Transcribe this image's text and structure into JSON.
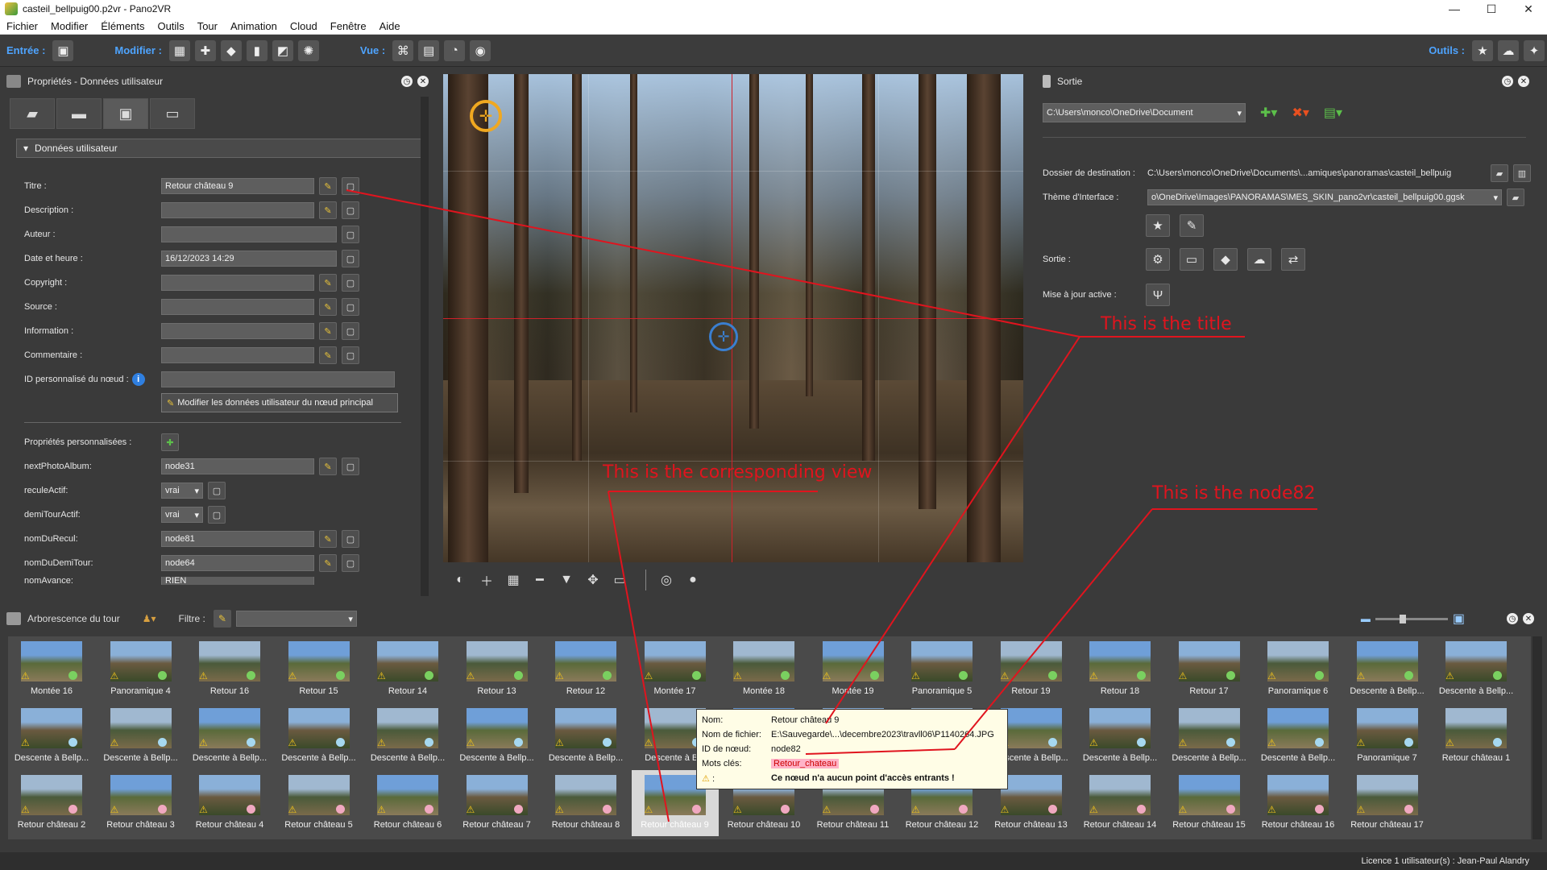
{
  "window": {
    "title": "casteil_bellpuig00.p2vr - Pano2VR",
    "minimize": "—",
    "maximize": "☐",
    "close": "✕"
  },
  "menu": [
    "Fichier",
    "Modifier",
    "Éléments",
    "Outils",
    "Tour",
    "Animation",
    "Cloud",
    "Fenêtre",
    "Aide"
  ],
  "toolbar": {
    "entree_label": "Entrée :",
    "modifier_label": "Modifier :",
    "vue_label": "Vue :",
    "outils_label": "Outils :"
  },
  "left_panel": {
    "title": "Propriétés - Données utilisateur",
    "section_title": "Données utilisateur",
    "fields": {
      "titre": {
        "label": "Titre :",
        "value": "Retour château 9"
      },
      "description": {
        "label": "Description :",
        "value": ""
      },
      "auteur": {
        "label": "Auteur :",
        "value": ""
      },
      "date": {
        "label": "Date et heure :",
        "value": "16/12/2023 14:29"
      },
      "copyright": {
        "label": "Copyright :",
        "value": ""
      },
      "source": {
        "label": "Source :",
        "value": ""
      },
      "information": {
        "label": "Information :",
        "value": ""
      },
      "commentaire": {
        "label": "Commentaire :",
        "value": ""
      },
      "id_noeud": {
        "label": "ID personnalisé du nœud :",
        "value": ""
      }
    },
    "modify_button": "Modifier les données utilisateur du nœud principal",
    "custom_props_label": "Propriétés personnalisées :",
    "custom": {
      "nextPhotoAlbum": {
        "label": "nextPhotoAlbum:",
        "value": "node31"
      },
      "reculeActif": {
        "label": "reculeActif:",
        "value": "vrai"
      },
      "demiTourActif": {
        "label": "demiTourActif:",
        "value": "vrai"
      },
      "nomDuRecul": {
        "label": "nomDuRecul:",
        "value": "node81"
      },
      "nomDuDemiTour": {
        "label": "nomDuDemiTour:",
        "value": "node64"
      },
      "nomAvance": {
        "label": "nomAvance:",
        "value": "RIEN"
      }
    }
  },
  "right_panel": {
    "title": "Sortie",
    "output_path": "C:\\Users\\monco\\OneDrive\\Document",
    "dest_label": "Dossier de destination :",
    "dest_value": "C:\\Users\\monco\\OneDrive\\Documents\\...amiques\\panoramas\\casteil_bellpuig",
    "theme_label": "Thème d'Interface :",
    "theme_value": "o\\OneDrive\\Images\\PANORAMAS\\MES_SKIN_pano2vr\\casteil_bellpuig00.ggsk",
    "sortie_label": "Sortie :",
    "update_label": "Mise à jour active :"
  },
  "tour": {
    "title": "Arborescence du tour",
    "filter_label": "Filtre :",
    "row1": [
      "Montée 16",
      "Panoramique 4",
      "Retour 16",
      "Retour 15",
      "Retour 14",
      "Retour 13",
      "Retour 12",
      "Montée 17",
      "Montée 18",
      "Montée 19",
      "Panoramique 5",
      "Retour 19",
      "Retour 18",
      "Retour 17",
      "Panoramique 6",
      "Descente à Bellp...",
      "Descente à Bellp..."
    ],
    "row2": [
      "Descente à Bellp...",
      "Descente à Bellp...",
      "Descente à Bellp...",
      "Descente à Bellp...",
      "Descente à Bellp...",
      "Descente à Bellp...",
      "Descente à Bellp...",
      "Descente à Bel",
      "",
      "",
      "",
      "Descente à Bellp...",
      "Descente à Bellp...",
      "Descente à Bellp...",
      "Descente à Bellp...",
      "Panoramique 7",
      "Retour château 1"
    ],
    "row3": [
      "Retour château 2",
      "Retour château 3",
      "Retour château 4",
      "Retour château 5",
      "Retour château 6",
      "Retour château 7",
      "Retour château 8",
      "Retour château 9",
      "Retour château 10",
      "Retour château 11",
      "Retour château 12",
      "Retour château 13",
      "Retour château 14",
      "Retour château 15",
      "Retour château 16",
      "Retour château 17"
    ]
  },
  "tooltip": {
    "nom_label": "Nom:",
    "nom_value": "Retour château 9",
    "fichier_label": "Nom de fichier:",
    "fichier_value": "E:\\Sauvegarde\\...\\decembre2023\\travll06\\P1140264.JPG",
    "id_label": "ID de nœud:",
    "id_value": "node82",
    "mots_label": "Mots clés:",
    "mots_value": "Retour_chateau",
    "warn_label": ":",
    "warn_value": "Ce nœud n'a aucun point d'accès entrants !"
  },
  "annotations": {
    "title_note": "This is the title",
    "view_note": "This is the corresponding view",
    "node_note": "This is the node82"
  },
  "status": {
    "licence": "Licence 1 utilisateur(s) : Jean-Paul Alandry"
  },
  "colors": {
    "accent": "#4ea4ff",
    "annotation": "#e0141e",
    "warning": "#f2c41a"
  }
}
